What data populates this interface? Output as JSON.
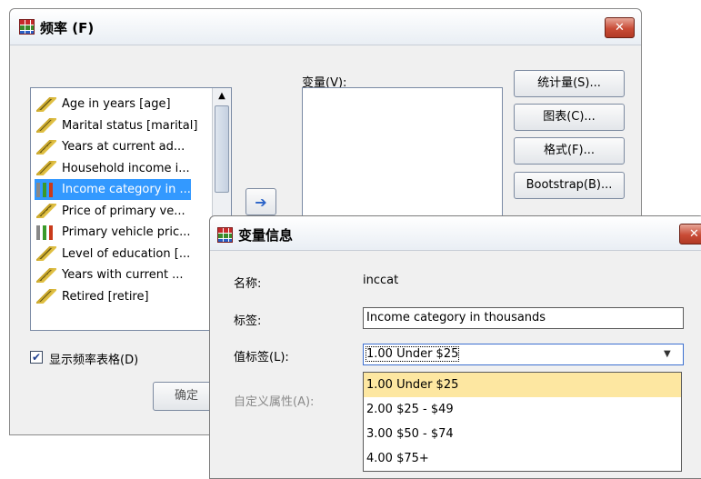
{
  "freq_dialog": {
    "title": "频率 (F)",
    "close_glyph": "✕",
    "variables_label": "变量(V):",
    "variables": [
      {
        "label": "Age in years [age]",
        "icon": "ruler"
      },
      {
        "label": "Marital status [marital]",
        "icon": "ruler"
      },
      {
        "label": "Years at current ad...",
        "icon": "ruler"
      },
      {
        "label": "Household income i...",
        "icon": "ruler"
      },
      {
        "label": "Income category in ...",
        "icon": "bar-chart"
      },
      {
        "label": "Price of primary ve...",
        "icon": "ruler"
      },
      {
        "label": "Primary vehicle pric...",
        "icon": "bar-chart"
      },
      {
        "label": "Level of education [...",
        "icon": "ruler"
      },
      {
        "label": "Years with current ...",
        "icon": "ruler"
      },
      {
        "label": "Retired [retire]",
        "icon": "ruler"
      }
    ],
    "selected_variable_index": 4,
    "move_arrow": "➔",
    "buttons": {
      "statistics": "统计量(S)...",
      "charts": "图表(C)...",
      "format": "格式(F)...",
      "bootstrap": "Bootstrap(B)...",
      "ok": "确定"
    },
    "show_tables_label": "显示频率表格(D)",
    "show_tables_checked": true,
    "checkmark": "✔"
  },
  "var_info": {
    "title": "变量信息",
    "close_glyph": "✕",
    "name_label": "名称:",
    "name_value": "inccat",
    "label_label": "标签:",
    "label_value": "Income category in thousands",
    "value_labels_label": "值标签(L):",
    "value_labels_selected": "1.00  Under $25",
    "custom_attr_label": "自定义属性(A):",
    "dropdown_arrow": "▼",
    "options": [
      "1.00  Under $25",
      "2.00  $25 - $49",
      "3.00  $50 - $74",
      "4.00  $75+"
    ],
    "highlighted_option_index": 0
  },
  "colors": {
    "selection": "#3399ff",
    "highlight_option": "#fde7a1",
    "window_bg": "#f0f0f0"
  }
}
